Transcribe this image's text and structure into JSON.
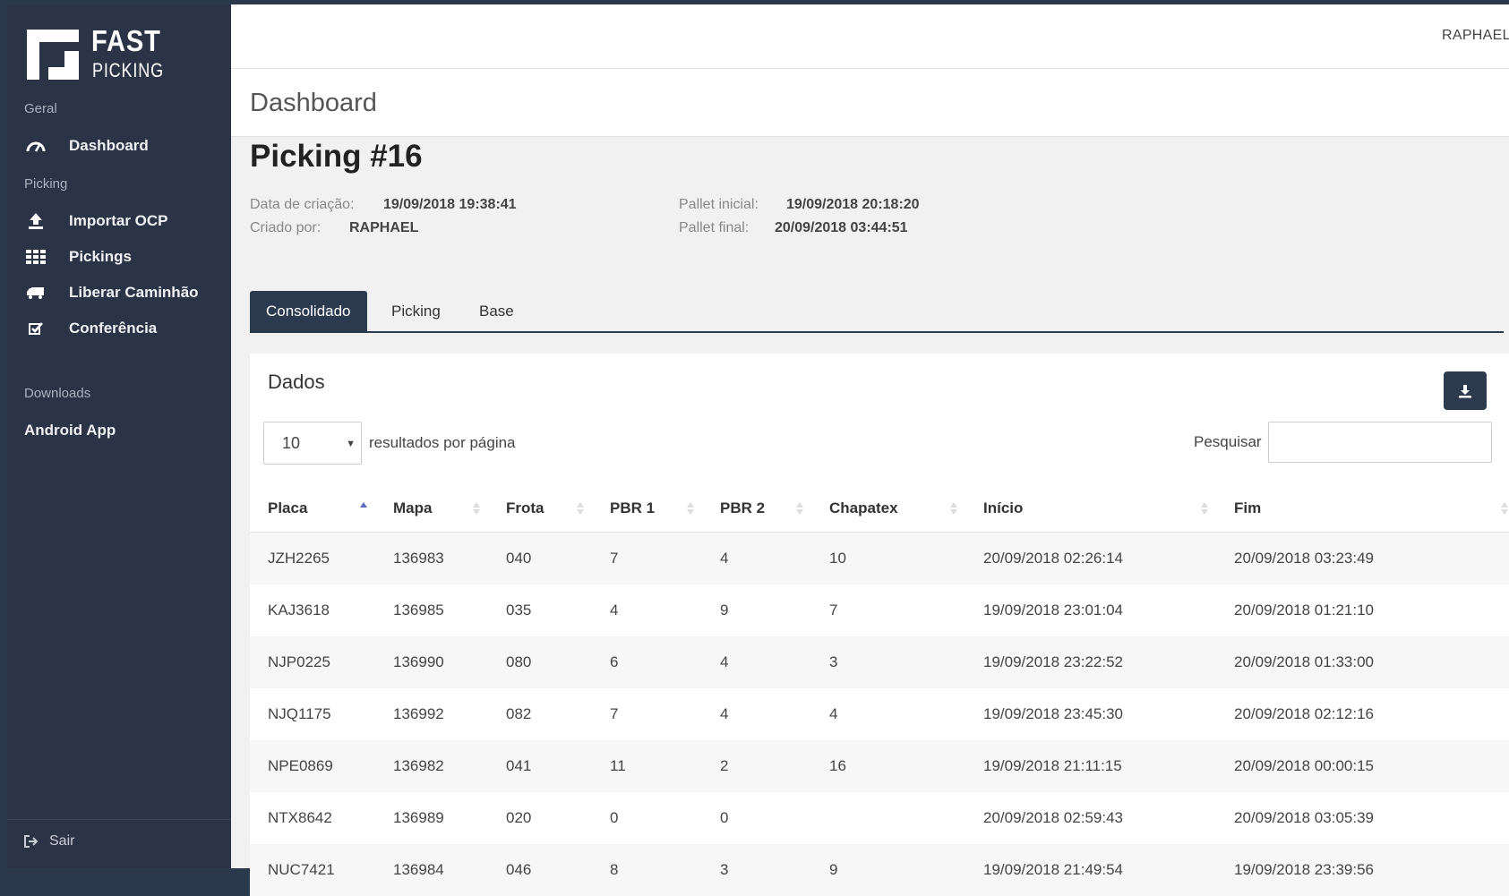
{
  "app": {
    "logo_line1": "FAST",
    "logo_line2": "PICKING",
    "user": "RAPHAEL"
  },
  "sidebar": {
    "sections": [
      {
        "label": "Geral"
      },
      {
        "label": "Picking"
      },
      {
        "label": "Downloads"
      }
    ],
    "items": [
      {
        "label": "Dashboard",
        "icon": "dashboard-gauge-icon"
      },
      {
        "label": "Importar OCP",
        "icon": "upload-icon"
      },
      {
        "label": "Pickings",
        "icon": "grid-icon"
      },
      {
        "label": "Liberar Caminhão",
        "icon": "truck-icon"
      },
      {
        "label": "Conferência",
        "icon": "checkbox-icon"
      },
      {
        "label": "Android App",
        "icon": ""
      }
    ],
    "logout_label": "Sair"
  },
  "header": {
    "title": "Dashboard"
  },
  "picking": {
    "title": "Picking #16",
    "created_label": "Data de criação:",
    "created_value": "19/09/2018 19:38:41",
    "created_by_label": "Criado por:",
    "created_by_value": "RAPHAEL",
    "pallet_start_label": "Pallet inicial:",
    "pallet_start_value": "19/09/2018 20:18:20",
    "pallet_end_label": "Pallet final:",
    "pallet_end_value": "20/09/2018 03:44:51"
  },
  "tabs": [
    {
      "label": "Consolidado",
      "active": true
    },
    {
      "label": "Picking",
      "active": false
    },
    {
      "label": "Base",
      "active": false
    }
  ],
  "panel": {
    "title": "Dados",
    "page_length": "10",
    "page_length_label": "resultados por página",
    "search_label": "Pesquisar",
    "search_value": ""
  },
  "table": {
    "columns": [
      "Placa",
      "Mapa",
      "Frota",
      "PBR 1",
      "PBR 2",
      "Chapatex",
      "Início",
      "Fim"
    ],
    "rows": [
      [
        "JZH2265",
        "136983",
        "040",
        "7",
        "4",
        "10",
        "20/09/2018 02:26:14",
        "20/09/2018 03:23:49"
      ],
      [
        "KAJ3618",
        "136985",
        "035",
        "4",
        "9",
        "7",
        "19/09/2018 23:01:04",
        "20/09/2018 01:21:10"
      ],
      [
        "NJP0225",
        "136990",
        "080",
        "6",
        "4",
        "3",
        "19/09/2018 23:22:52",
        "20/09/2018 01:33:00"
      ],
      [
        "NJQ1175",
        "136992",
        "082",
        "7",
        "4",
        "4",
        "19/09/2018 23:45:30",
        "20/09/2018 02:12:16"
      ],
      [
        "NPE0869",
        "136982",
        "041",
        "11",
        "2",
        "16",
        "19/09/2018 21:11:15",
        "20/09/2018 00:00:15"
      ],
      [
        "NTX8642",
        "136989",
        "020",
        "0",
        "0",
        "",
        "20/09/2018 02:59:43",
        "20/09/2018 03:05:39"
      ],
      [
        "NUC7421",
        "136984",
        "046",
        "8",
        "3",
        "9",
        "19/09/2018 21:49:54",
        "19/09/2018 23:39:56"
      ]
    ]
  },
  "colors": {
    "sidebar_bg": "#2b3346",
    "accent": "#2b3a4e",
    "sort_active": "#5b6bc0"
  }
}
